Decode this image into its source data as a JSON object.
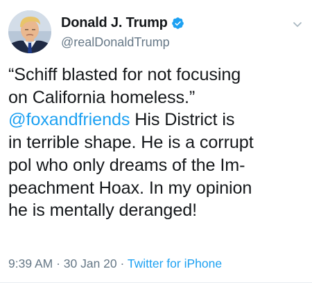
{
  "author": {
    "display_name": "Donald J. Trump",
    "handle": "@realDonaldTrump",
    "verified": true,
    "avatar_icon": "profile-photo"
  },
  "tweet": {
    "line1": "“Schiff blasted for not focusing",
    "line2": "on California homeless.”",
    "mention": "@foxandfriends",
    "line3_rest": "  His District is",
    "line4": "in terrible shape. He is a corrupt",
    "line5": "pol who only dreams of the Im-",
    "line6": "peachment Hoax. In my opinion",
    "line7": "he is mentally deranged!"
  },
  "meta": {
    "time": "9:39 AM",
    "separator1": " · ",
    "date": "30 Jan 20",
    "separator2": " · ",
    "source": "Twitter for iPhone"
  },
  "colors": {
    "link": "#1da1f2",
    "secondary_text": "#657786",
    "primary_text": "#14171a",
    "divider": "#e6ecf0"
  },
  "icons": {
    "verified": "verified-badge-icon",
    "menu": "chevron-down-icon"
  }
}
